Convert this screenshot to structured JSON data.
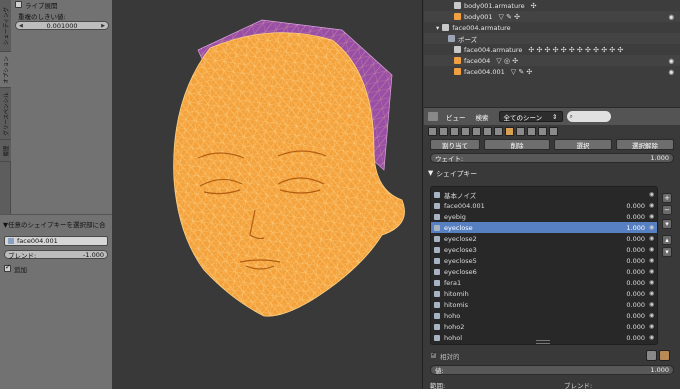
{
  "left_panel": {
    "tabs": [
      "シェーディング",
      "オプション",
      "グリースペンシル",
      "履歴"
    ],
    "live_unwrap_label": "ライブ展開",
    "live_unwrap_checked": false,
    "threshold_label": "重複のしきい値:",
    "threshold_value": "0.001000"
  },
  "operator_panel": {
    "title": "▼任意のシェイプキーを選択部に合",
    "shape_name": "face004.001",
    "blend_label": "ブレンド:",
    "blend_value": "-1.000",
    "add_label": "追加",
    "add_checked": true
  },
  "outliner": {
    "rows": [
      {
        "name": "body001.armature",
        "indent": 3
      },
      {
        "name": "body001",
        "indent": 3
      },
      {
        "name": "face004.armature",
        "indent": 1
      },
      {
        "name": "ポーズ",
        "indent": 2
      },
      {
        "name": "face004.armature",
        "indent": 3
      },
      {
        "name": "face004",
        "indent": 3
      },
      {
        "name": "face004.001",
        "indent": 3
      }
    ]
  },
  "properties": {
    "header": {
      "view": "ビュー",
      "search": "検索",
      "scene_select": "全てのシーン"
    },
    "buttons": {
      "assign": "割り当て",
      "delete": "削除",
      "select": "選択",
      "deselect": "選択解除"
    },
    "weight": {
      "label": "ウェイト:",
      "value": "1.000"
    },
    "shape_keys_title": "シェイプキー",
    "shape_keys": [
      {
        "name": "基本ノイズ",
        "value": ""
      },
      {
        "name": "face004.001",
        "value": "0.000"
      },
      {
        "name": "eyebig",
        "value": "0.000"
      },
      {
        "name": "eyeclose",
        "value": "1.000"
      },
      {
        "name": "eyeclose2",
        "value": "0.000"
      },
      {
        "name": "eyeclose3",
        "value": "0.000"
      },
      {
        "name": "eyeclose5",
        "value": "0.000"
      },
      {
        "name": "eyeclose6",
        "value": "0.000"
      },
      {
        "name": "fera1",
        "value": "0.000"
      },
      {
        "name": "hitomih",
        "value": "0.000"
      },
      {
        "name": "hitomis",
        "value": "0.000"
      },
      {
        "name": "hoho",
        "value": "0.000"
      },
      {
        "name": "hoho2",
        "value": "0.000"
      },
      {
        "name": "hohol",
        "value": "0.000"
      }
    ],
    "selected_key": "eyeclose",
    "relative_label": "相対的",
    "value_label": "値:",
    "value": "1.000",
    "range_label": "範囲:",
    "blend_label": "ブレンド:"
  },
  "colors": {
    "mesh_orange": "#f4a23c",
    "mesh_hair": "#9a4fa6",
    "wire": "#ffcf80",
    "selection_blue": "#5680c2"
  }
}
